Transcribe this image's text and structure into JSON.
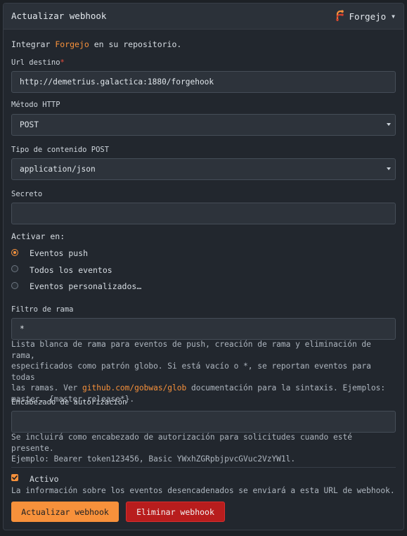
{
  "header": {
    "title": "Actualizar webhook",
    "provider_label": "Forgejo",
    "provider_icon": "forgejo-logo-icon",
    "caret_icon": "caret-down-icon"
  },
  "intro": {
    "prefix": "Integrar ",
    "link": "Forgejo",
    "suffix": " en su repositorio."
  },
  "url_field": {
    "label": "Url destino",
    "required_mark": "*",
    "value": "http://demetrius.galactica:1880/forgehook"
  },
  "method_field": {
    "label": "Método HTTP",
    "value": "POST"
  },
  "content_type_field": {
    "label": "Tipo de contenido POST",
    "value": "application/json"
  },
  "secret_field": {
    "label": "Secreto",
    "value": ""
  },
  "trigger": {
    "label": "Activar en:",
    "options": [
      {
        "label": "Eventos push",
        "checked": true
      },
      {
        "label": "Todos los eventos",
        "checked": false
      },
      {
        "label": "Eventos personalizados…",
        "checked": false
      }
    ]
  },
  "branch_filter": {
    "label": "Filtro de rama",
    "value": "*",
    "help_line1": "Lista blanca de rama para eventos de push, creación de rama y eliminación de rama,",
    "help_line2": "especificados como patrón globo. Si está vacío o *, se reportan eventos para todas",
    "help_line3_prefix": "las ramas. Ver ",
    "help_link": "github.com/gobwas/glob",
    "help_line3_suffix": " documentación para la sintaxis. Ejemplos:",
    "help_line4": "master, {master,release*}."
  },
  "auth_header": {
    "label": "Encabezado de autorización",
    "value": "",
    "help_line1": "Se incluirá como encabezado de autorización para solicitudes cuando esté presente.",
    "help_line2": "Ejemplo: Bearer token123456, Basic YWxhZGRpbjpvcGVuc2VzYW1l."
  },
  "active": {
    "label": "Activo",
    "checked": true,
    "help": "La información sobre los eventos desencadenados se enviará a esta URL de webhook."
  },
  "buttons": {
    "update": "Actualizar webhook",
    "delete": "Eliminar webhook"
  },
  "colors": {
    "accent": "#f7913b",
    "danger": "#b81d1d",
    "background": "#22272e"
  }
}
